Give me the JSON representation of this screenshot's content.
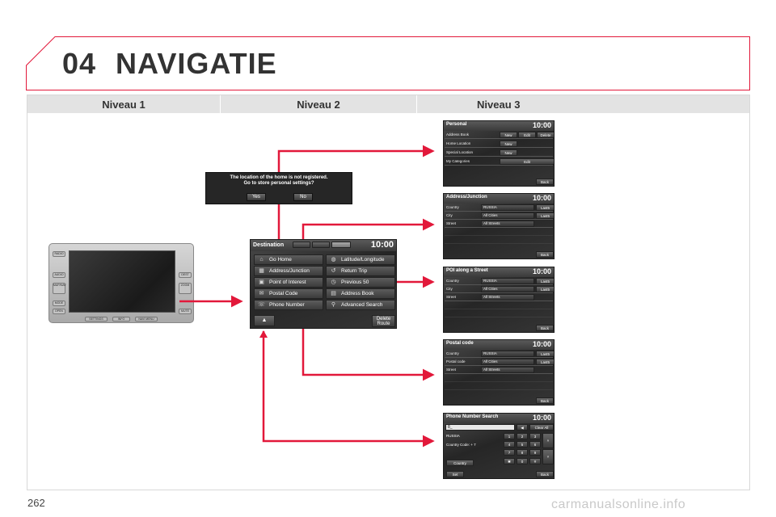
{
  "page": {
    "chapter_number": "04",
    "chapter_title": "NAVIGATIE",
    "page_number": "262",
    "watermark": "carmanualsonline.info"
  },
  "columns": [
    "Niveau 1",
    "Niveau 2",
    "Niveau 3"
  ],
  "colors": {
    "accent": "#e2183a",
    "frame": "#e2183a",
    "header_bg": "#e3e3e3",
    "screen_bg": "#2e2e2e"
  },
  "device": {
    "left_buttons": [
      "RADIO",
      "AUDIO",
      "MAP/NAV",
      "MODE",
      "OPEN"
    ],
    "right_buttons": [
      "DEST",
      "ZOOM",
      "MUTE"
    ],
    "bottom_buttons": [
      "SETTINGS",
      "INFO",
      "NAVI MENU"
    ]
  },
  "dialog": {
    "line1": "The location of the home is not registered.",
    "line2": "Go to store personal settings?",
    "yes": "Yes",
    "no": "No"
  },
  "destination": {
    "title": "Destination",
    "time": "10:00",
    "items": [
      {
        "label": "Go Home",
        "icon": "home-icon"
      },
      {
        "label": "Latitude/Longitude",
        "icon": "globe-icon"
      },
      {
        "label": "Address/Junction",
        "icon": "map-icon"
      },
      {
        "label": "Return Trip",
        "icon": "return-icon"
      },
      {
        "label": "Point of Interest",
        "icon": "poi-icon"
      },
      {
        "label": "Previous 50",
        "icon": "history-icon"
      },
      {
        "label": "Postal Code",
        "icon": "mail-icon"
      },
      {
        "label": "Address Book",
        "icon": "book-icon"
      },
      {
        "label": "Phone Number",
        "icon": "phone-icon"
      },
      {
        "label": "Advanced Search",
        "icon": "search-icon"
      }
    ],
    "delete_route_1": "Delete",
    "delete_route_2": "Route"
  },
  "personal": {
    "title": "Personal",
    "time": "10:00",
    "rows": [
      {
        "label": "Address Book",
        "buttons": [
          "New",
          "Edit",
          "Delete"
        ]
      },
      {
        "label": "Home Location",
        "buttons": [
          "New"
        ]
      },
      {
        "label": "Special Location",
        "buttons": [
          "New"
        ]
      },
      {
        "label": "My Categories",
        "buttons": [
          "Edit"
        ]
      }
    ],
    "back": "Back"
  },
  "address_junction": {
    "title": "Address/Junction",
    "time": "10:00",
    "rows": [
      {
        "label": "Country",
        "value": "RUSSIA",
        "btn": "Last5"
      },
      {
        "label": "City",
        "value": "All Cities",
        "btn": "Last5"
      },
      {
        "label": "Street",
        "value": "All Streets",
        "btn": ""
      }
    ],
    "back": "Back"
  },
  "poi_street": {
    "title": "POI along a Street",
    "time": "10:00",
    "rows": [
      {
        "label": "Country",
        "value": "RUSSIA",
        "btn": "Last5"
      },
      {
        "label": "City",
        "value": "All Cities",
        "btn": "Last5"
      },
      {
        "label": "Street",
        "value": "All Streets",
        "btn": ""
      }
    ],
    "back": "Back"
  },
  "postal_code": {
    "title": "Postal code",
    "time": "10:00",
    "rows": [
      {
        "label": "Country",
        "value": "RUSSIA",
        "btn": "Last5"
      },
      {
        "label": "Postal code",
        "value": "All Cities",
        "btn": "Last5"
      },
      {
        "label": "Street",
        "value": "All Streets",
        "btn": ""
      }
    ],
    "back": "Back"
  },
  "phone_search": {
    "title": "Phone Number Search",
    "time": "10:00",
    "input": "8_",
    "clear_all": "Clear All",
    "country": "RUSSIA",
    "country_code": "Country Code: + 7",
    "country_btn": "Country",
    "set": "Set",
    "back": "Back",
    "keys": [
      "1",
      "2",
      "3",
      "4",
      "5",
      "6",
      "7",
      "8",
      "9",
      "0"
    ]
  }
}
